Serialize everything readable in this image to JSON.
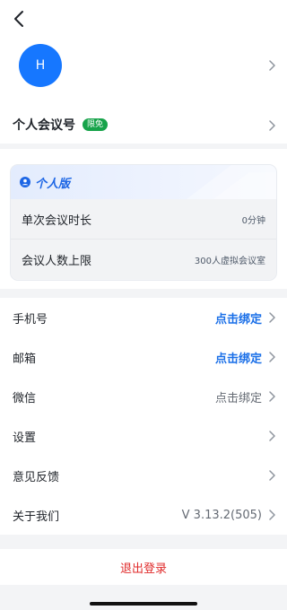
{
  "profile": {
    "avatar_letter": "H"
  },
  "personal_meeting": {
    "title": "个人会议号",
    "badge": "限免"
  },
  "plan_card": {
    "plan_name": "个人版",
    "rows": [
      {
        "label": "单次会议时长",
        "value": "0分钟"
      },
      {
        "label": "会议人数上限",
        "value": "300人虚拟会议室"
      }
    ]
  },
  "settings_list": [
    {
      "label": "手机号",
      "value": "点击绑定",
      "style": "blue"
    },
    {
      "label": "邮箱",
      "value": "点击绑定",
      "style": "blue"
    },
    {
      "label": "微信",
      "value": "点击绑定",
      "style": "gray"
    },
    {
      "label": "设置",
      "value": "",
      "style": "gray"
    },
    {
      "label": "意见反馈",
      "value": "",
      "style": "gray"
    },
    {
      "label": "关于我们",
      "value": "V 3.13.2(505)",
      "style": "gray"
    }
  ],
  "logout": {
    "label": "退出登录"
  },
  "colors": {
    "accent": "#1677ff",
    "link": "#1a6fe8",
    "danger": "#e02b2b",
    "badge": "#17a34a"
  }
}
